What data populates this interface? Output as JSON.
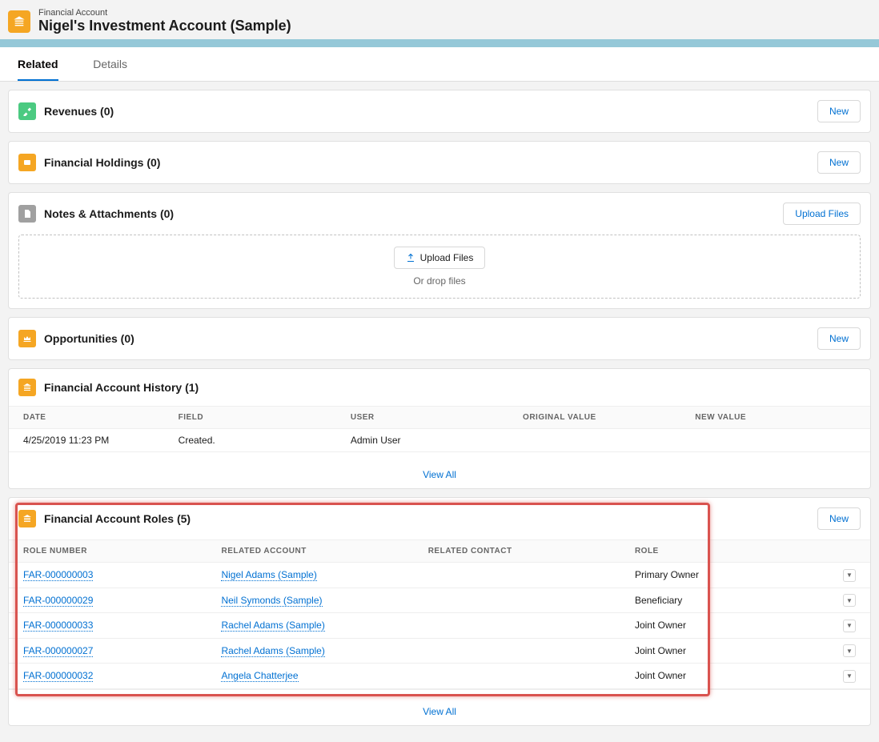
{
  "header": {
    "kicker": "Financial Account",
    "title": "Nigel's Investment Account (Sample)"
  },
  "tabs": {
    "related": "Related",
    "details": "Details"
  },
  "buttons": {
    "new": "New",
    "upload": "Upload Files",
    "view_all": "View All"
  },
  "drop_hint": "Or drop files",
  "cards": {
    "revenues": "Revenues (0)",
    "holdings": "Financial Holdings (0)",
    "notes": "Notes & Attachments (0)",
    "opps": "Opportunities (0)",
    "history": "Financial Account History (1)",
    "roles": "Financial Account Roles (5)"
  },
  "history": {
    "headers": {
      "date": "Date",
      "field": "Field",
      "user": "User",
      "orig": "Original Value",
      "newv": "New Value"
    },
    "rows": [
      {
        "date": "4/25/2019 11:23 PM",
        "field": "Created.",
        "user": "Admin User",
        "orig": "",
        "newv": ""
      }
    ]
  },
  "roles": {
    "headers": {
      "num": "Role Number",
      "acct": "Related Account",
      "contact": "Related Contact",
      "role": "Role"
    },
    "rows": [
      {
        "num": "FAR-000000003",
        "acct": "Nigel Adams (Sample)",
        "contact": "",
        "role": "Primary Owner"
      },
      {
        "num": "FAR-000000029",
        "acct": "Neil Symonds (Sample)",
        "contact": "",
        "role": "Beneficiary"
      },
      {
        "num": "FAR-000000033",
        "acct": "Rachel Adams (Sample)",
        "contact": "",
        "role": "Joint Owner"
      },
      {
        "num": "FAR-000000027",
        "acct": "Rachel Adams (Sample)",
        "contact": "",
        "role": "Joint Owner"
      },
      {
        "num": "FAR-000000032",
        "acct": "Angela Chatterjee",
        "contact": "",
        "role": "Joint Owner"
      }
    ]
  }
}
